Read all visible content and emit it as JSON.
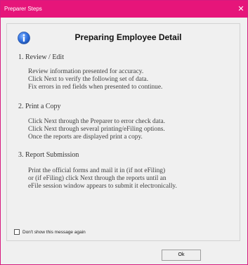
{
  "window": {
    "title": "Preparer Steps",
    "close_glyph": "✕",
    "accent_color": "#e6157a"
  },
  "content": {
    "icon": "info-icon",
    "heading": "Preparing Employee Detail",
    "sections": [
      {
        "title": "1. Review / Edit",
        "lines": [
          "Review information presented for accuracy.",
          "Click Next to verify the following set of data.",
          "Fix errors in red fields when presented to continue."
        ]
      },
      {
        "title": "2. Print a Copy",
        "lines": [
          "Click Next through the Preparer to error check data.",
          "Click Next through several printing/eFiling options.",
          "Once the reports are displayed print a copy."
        ]
      },
      {
        "title": "3. Report Submission",
        "lines": [
          "Print the official forms and mail it in (if not eFiling)",
          "or (if eFiling) click Next through the reports until an",
          "eFile session window appears to submit it electronically."
        ]
      }
    ]
  },
  "footer": {
    "checkbox_label": "Don't show this message again",
    "checkbox_checked": false,
    "ok_label": "Ok"
  }
}
